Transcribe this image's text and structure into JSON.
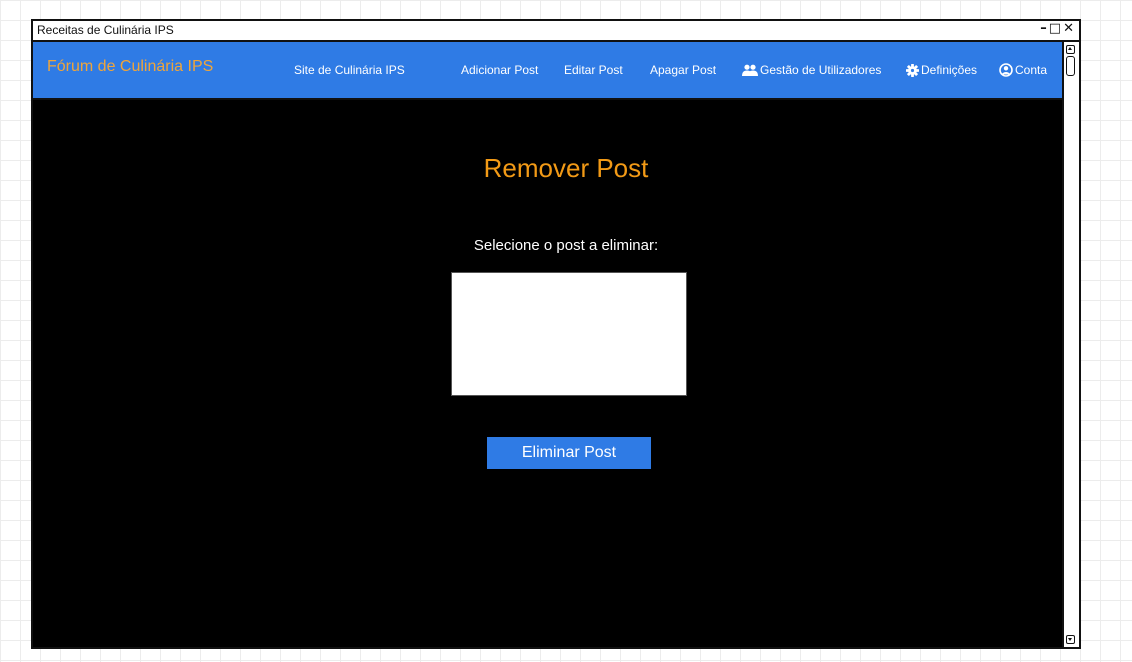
{
  "window": {
    "title": "Receitas de Culinária IPS",
    "controls": {
      "minimize": "–",
      "maximize": "□",
      "close": "✕"
    }
  },
  "navbar": {
    "brand": "Fórum de Culinária IPS",
    "links": {
      "site": "Site de Culinária IPS",
      "add_post": "Adicionar Post",
      "edit_post": "Editar Post",
      "delete_post": "Apagar Post",
      "user_management": "Gestão de Utilizadores",
      "settings": "Definições",
      "account": "Conta"
    },
    "icons": {
      "user_management": "users-icon",
      "settings": "gear-icon",
      "account": "user-circle-icon"
    }
  },
  "main": {
    "heading": "Remover Post",
    "select_label": "Selecione o post a eliminar:",
    "submit_label": "Eliminar Post"
  },
  "colors": {
    "accent_blue": "#2f7be5",
    "heading_orange": "#f29a16",
    "brand_orange": "#f0a53a",
    "background": "#000000"
  }
}
